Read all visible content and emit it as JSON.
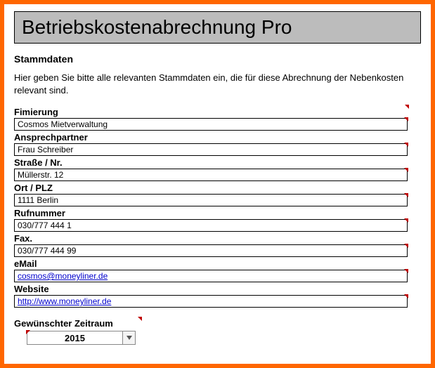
{
  "header": {
    "title": "Betriebskostenabrechnung Pro"
  },
  "section": {
    "heading": "Stammdaten",
    "intro": "Hier geben Sie bitte alle relevanten Stammdaten ein, die für diese Abrechnung der Nebenkosten relevant sind."
  },
  "fields": {
    "fimierung": {
      "label": "Fimierung",
      "value": "Cosmos Mietverwaltung"
    },
    "ansprechpartner": {
      "label": "Ansprechpartner",
      "value": "Frau Schreiber"
    },
    "strasse": {
      "label": "Straße / Nr.",
      "value": "Müllerstr. 12"
    },
    "ort": {
      "label": "Ort / PLZ",
      "value": "1111 Berlin"
    },
    "rufnummer": {
      "label": "Rufnummer",
      "value": "030/777 444 1"
    },
    "fax": {
      "label": "Fax.",
      "value": "030/777 444 99"
    },
    "email": {
      "label": "eMail",
      "value": "cosmos@moneyliner.de"
    },
    "website": {
      "label": "Website",
      "value": "http://www.moneyliner.de"
    }
  },
  "zeitraum": {
    "label": "Gewünschter Zeitraum",
    "value": "2015"
  }
}
